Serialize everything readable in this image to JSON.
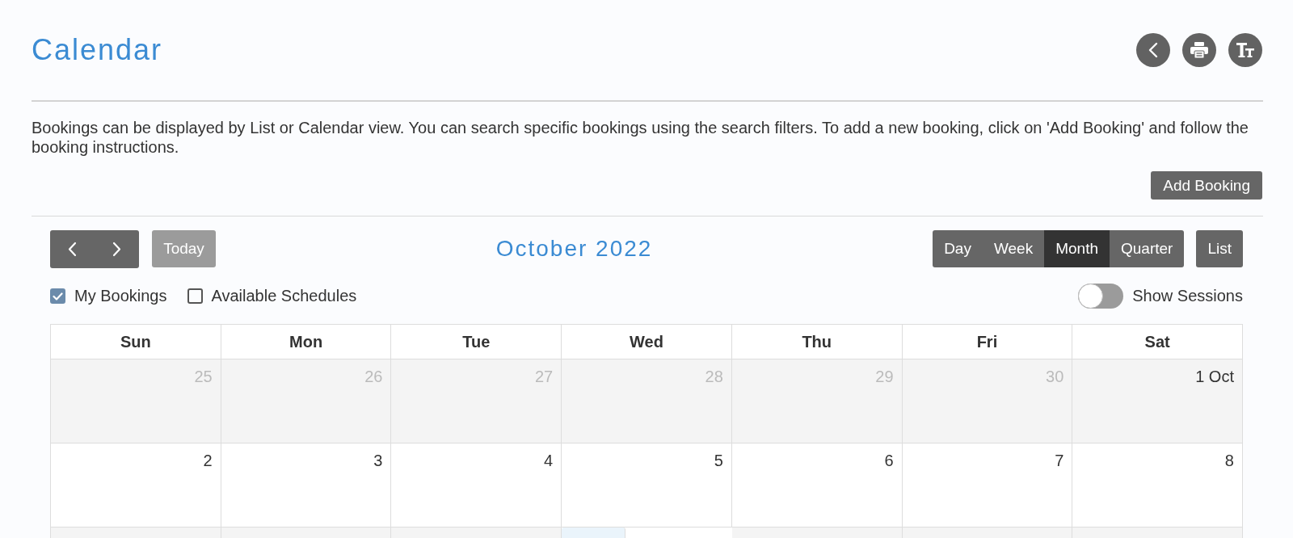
{
  "page": {
    "title": "Calendar"
  },
  "description": "Bookings can be displayed by List or Calendar view. You can search specific bookings using the search filters. To add a new booking, click on 'Add Booking' and follow the booking instructions.",
  "add_button": "Add Booking",
  "toolbar": {
    "today": {
      "label": "Today",
      "disabled": true
    },
    "month_title": "October 2022",
    "views": [
      {
        "label": "Day",
        "selected": false
      },
      {
        "label": "Week",
        "selected": false
      },
      {
        "label": "Month",
        "selected": true
      },
      {
        "label": "Quarter",
        "selected": false
      }
    ],
    "list_button": "List"
  },
  "filters": [
    {
      "label": "My Bookings",
      "checked": true
    },
    {
      "label": "Available Schedules",
      "checked": false
    }
  ],
  "show_sessions": {
    "label": "Show Sessions",
    "on": false
  },
  "calendar": {
    "columns": [
      "Sun",
      "Mon",
      "Tue",
      "Wed",
      "Thu",
      "Fri",
      "Sat"
    ],
    "weeks": [
      {
        "days": [
          {
            "label": "25",
            "other_month": true,
            "today": false
          },
          {
            "label": "26",
            "other_month": true,
            "today": false
          },
          {
            "label": "27",
            "other_month": true,
            "today": false
          },
          {
            "label": "28",
            "other_month": true,
            "today": false
          },
          {
            "label": "29",
            "other_month": true,
            "today": false
          },
          {
            "label": "30",
            "other_month": true,
            "today": false
          },
          {
            "label": "1 Oct",
            "other_month": false,
            "today": false
          }
        ]
      },
      {
        "days": [
          {
            "label": "2",
            "other_month": false,
            "today": false
          },
          {
            "label": "3",
            "other_month": false,
            "today": false
          },
          {
            "label": "4",
            "other_month": false,
            "today": false
          },
          {
            "label": "5",
            "other_month": false,
            "today": false
          },
          {
            "label": "6",
            "other_month": false,
            "today": false
          },
          {
            "label": "7",
            "other_month": false,
            "today": false
          },
          {
            "label": "8",
            "other_month": false,
            "today": false
          }
        ]
      },
      {
        "days": [
          {
            "today": false
          },
          {
            "today": false
          },
          {
            "today": false
          },
          {
            "today": true
          },
          {
            "today": false
          },
          {
            "today": false
          },
          {
            "today": false
          }
        ]
      }
    ]
  }
}
